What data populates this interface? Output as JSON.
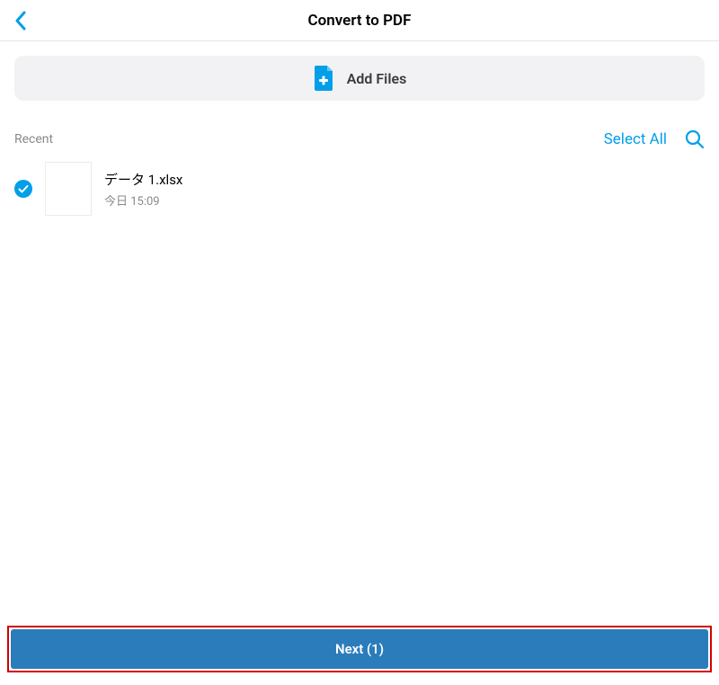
{
  "header": {
    "title": "Convert to PDF"
  },
  "addFiles": {
    "label": "Add Files"
  },
  "section": {
    "title": "Recent",
    "selectAll": "Select All"
  },
  "files": [
    {
      "name": "データ 1.xlsx",
      "timestamp": "今日 15:09",
      "selected": true
    }
  ],
  "footer": {
    "next": "Next (1)"
  },
  "colors": {
    "accent": "#009fe8",
    "primaryBtn": "#2b7cba",
    "highlight": "#d40000"
  }
}
